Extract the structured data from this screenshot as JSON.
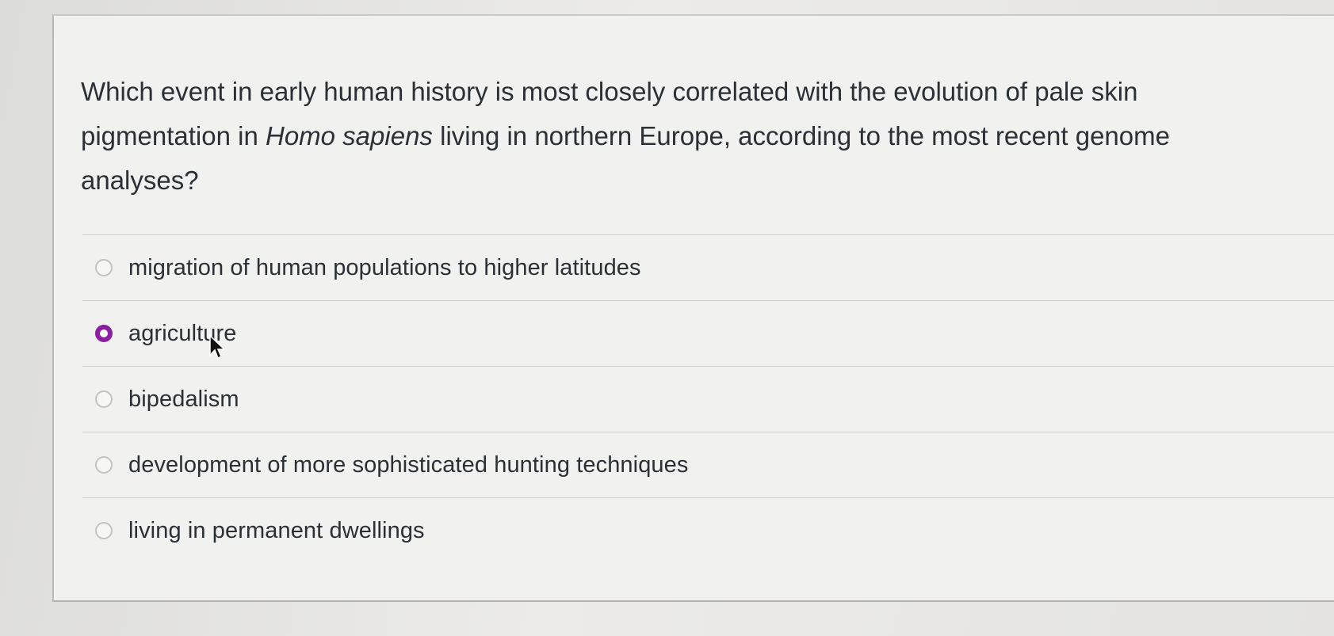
{
  "question": {
    "part1": "Which event in early human history is most closely correlated with the evolution of pale skin pigmentation in ",
    "emphasis": "Homo sapiens",
    "part2": " living in northern Europe, according to the most recent genome analyses?"
  },
  "answers": [
    {
      "label": "migration of human populations to higher latitudes",
      "selected": false
    },
    {
      "label": "agriculture",
      "selected": true
    },
    {
      "label": "bipedalism",
      "selected": false
    },
    {
      "label": "development of more sophisticated hunting techniques",
      "selected": false
    },
    {
      "label": "living in permanent dwellings",
      "selected": false
    }
  ],
  "colors": {
    "selected_radio": "#8a1fa0",
    "text": "#2a3036"
  }
}
